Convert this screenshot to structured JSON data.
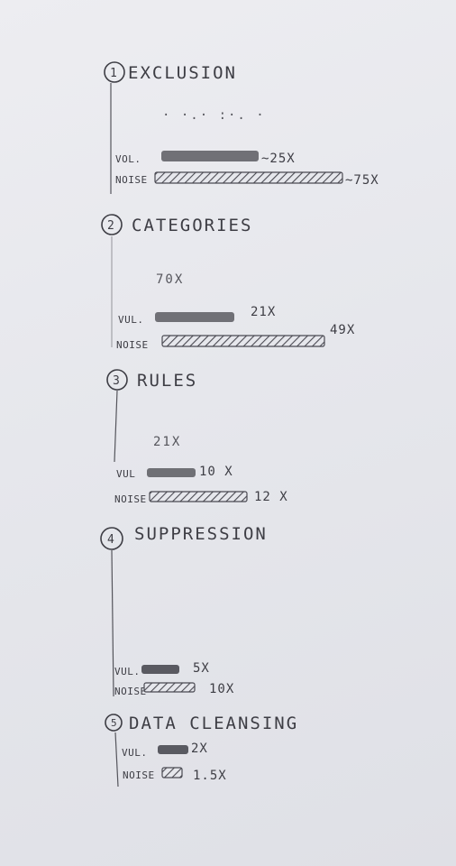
{
  "sections": [
    {
      "number": "1",
      "title": "EXCLUSION",
      "midnote": "",
      "vol_label": "VOL.",
      "vol_value": "~25X",
      "noise_label": "NOISE",
      "noise_value": "~75X"
    },
    {
      "number": "2",
      "title": "CATEGORIES",
      "midnote": "70X",
      "vol_label": "VUL.",
      "vol_value": "21X",
      "noise_label": "NOISE",
      "noise_value": "49X"
    },
    {
      "number": "3",
      "title": "RULES",
      "midnote": "21X",
      "vol_label": "VUL",
      "vol_value": "10 X",
      "noise_label": "NOISE",
      "noise_value": "12 X"
    },
    {
      "number": "4",
      "title": "SUPPRESSION",
      "midnote": "",
      "vol_label": "VUL.",
      "vol_value": "5X",
      "noise_label": "NOISE",
      "noise_value": "10X"
    },
    {
      "number": "5",
      "title": "DATA CLEANSING",
      "midnote": "",
      "vol_label": "VUL.",
      "vol_value": "2X",
      "noise_label": "NOISE",
      "noise_value": "1.5X"
    }
  ],
  "colors": {
    "paper": "#e8e9ee",
    "pencil": "#3d3d44",
    "shade": "#5a5a60"
  }
}
